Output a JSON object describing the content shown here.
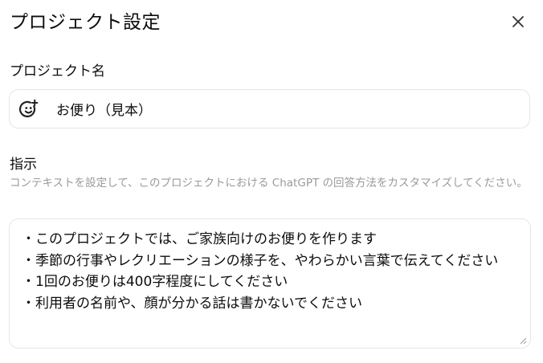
{
  "dialog": {
    "title": "プロジェクト設定",
    "close_icon": "close-icon"
  },
  "project_name": {
    "label": "プロジェクト名",
    "value": "お便り（見本）",
    "emoji_icon": "emoji-add-icon"
  },
  "instructions": {
    "label": "指示",
    "description": "コンテキストを設定して、このプロジェクトにおける ChatGPT の回答方法をカスタマイズしてください。",
    "text": "・このプロジェクトでは、ご家族向けのお便りを作ります\n・季節の行事やレクリエーションの様子を、やわらかい言葉で伝えてください\n・1回のお便りは400字程度にしてください\n・利用者の名前や、顔が分かる話は書かないでください",
    "resize_icon": "resize-handle-icon"
  }
}
